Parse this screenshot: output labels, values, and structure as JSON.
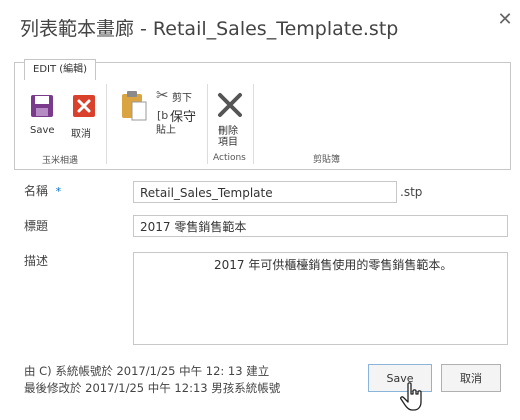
{
  "dialog": {
    "title": "列表範本畫廊 - Retail_Sales_Template.stp",
    "close_glyph": "✕"
  },
  "ribbon": {
    "tab_label": "EDIT (編輯)",
    "save_label": "Save",
    "cancel_label": "取消",
    "group1_label": "玉米相遇",
    "cut_label": "剪下",
    "copy_label": "保守",
    "paste_label": "貼上",
    "delete_label_line1": "刪除",
    "delete_label_line2": "項目",
    "actions_label": "Actions",
    "clipboard_label": "剪貼簿"
  },
  "form": {
    "name_label": "名稱",
    "required_marker": "*",
    "name_value": "Retail_Sales_Template",
    "file_extension": ".stp",
    "title_label": "標題",
    "title_value": "2017 零售銷售範本",
    "description_label": "描述",
    "description_value": "2017 年可供櫃檯銷售使用的零售銷售範本。"
  },
  "footer": {
    "created_text": "由 C) 系統帳號於 2017/1/25 中午 12: 13 建立",
    "modified_text": "最後修改於 2017/1/25 中午 12:13 男孩系統帳號",
    "save_button": "Save",
    "cancel_button": "取消"
  },
  "colors": {
    "save_icon": "#7a3b8c",
    "cancel_icon": "#d9412c",
    "required_marker": "#0072c6"
  }
}
